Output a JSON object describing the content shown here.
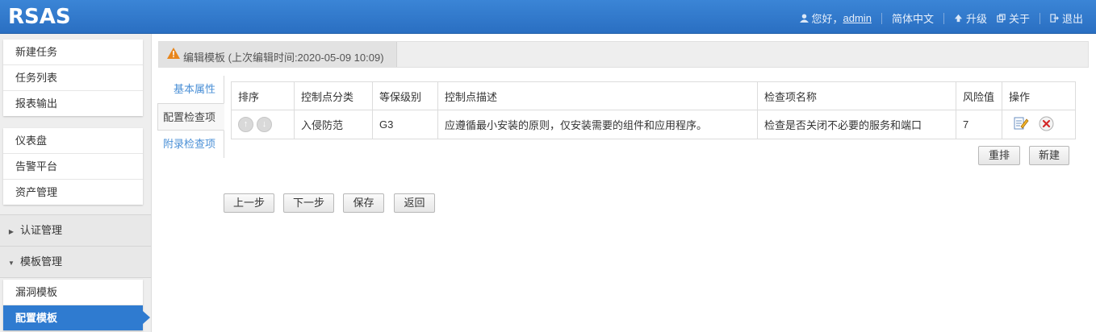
{
  "header": {
    "logo": "RSAS",
    "greeting": "您好，",
    "username": "admin",
    "language": "简体中文",
    "upgrade": "升级",
    "about": "关于",
    "logout": "退出"
  },
  "sidebar": {
    "group1": [
      "新建任务",
      "任务列表",
      "报表输出"
    ],
    "group2": [
      "仪表盘",
      "告警平台",
      "资产管理"
    ],
    "section_auth": "认证管理",
    "section_template": "模板管理",
    "group3": [
      "漏洞模板",
      "配置模板"
    ]
  },
  "titlebar": {
    "text": "编辑模板 (上次编辑时间:2020-05-09 10:09)"
  },
  "tabs": [
    "基本属性",
    "配置检查项",
    "附录检查项"
  ],
  "table": {
    "headers": [
      "排序",
      "控制点分类",
      "等保级别",
      "控制点描述",
      "检查项名称",
      "风险值",
      "操作"
    ],
    "rows": [
      {
        "category": "入侵防范",
        "level": "G3",
        "description": "应遵循最小安装的原则，仅安装需要的组件和应用程序。",
        "check_name": "检查是否关闭不必要的服务和端口",
        "risk": "7"
      }
    ]
  },
  "table_buttons": {
    "reorder": "重排",
    "new": "新建"
  },
  "footer_buttons": {
    "prev": "上一步",
    "next": "下一步",
    "save": "保存",
    "back": "返回"
  },
  "colors": {
    "header": "#2f7bd0",
    "active": "#2f7bd0",
    "tab_link": "#4a8fd6"
  }
}
